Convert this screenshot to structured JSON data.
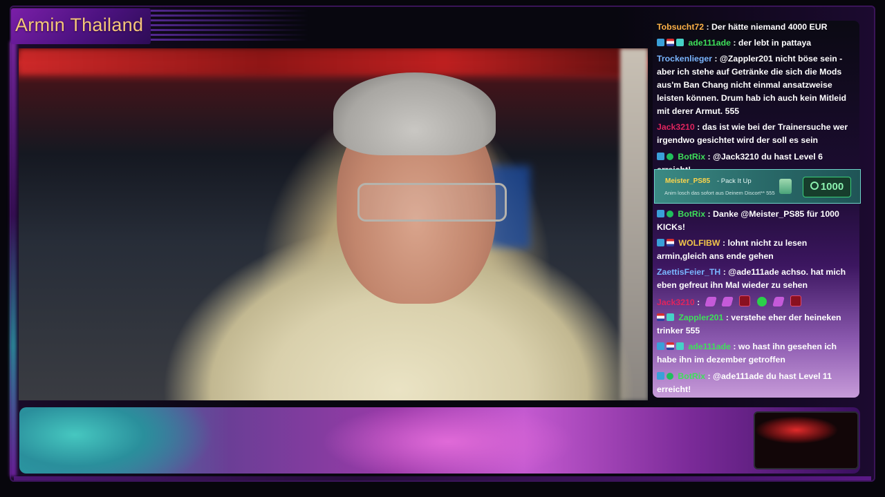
{
  "overlay": {
    "title": "Armin Thailand"
  },
  "chat": {
    "messages": [
      {
        "user": "Tobsucht72",
        "color": "#ffb347",
        "badges": [],
        "text": ": Der hätte niemand 4000 EUR"
      },
      {
        "user": "ade111ade",
        "color": "#3ee05a",
        "badges": [
          "sub",
          "flag",
          "gift"
        ],
        "text": ": der lebt in pattaya"
      },
      {
        "user": "Trockenlieger",
        "color": "#7ab6ff",
        "badges": [],
        "text": ": @Zappler201 nicht böse sein - aber ich stehe auf Getränke die sich die Mods aus'm Ban Chang nicht einmal ansatzweise leisten können. Drum hab ich auch kein Mitleid mit derer Armut. 555"
      },
      {
        "user": "Jack3210",
        "color": "#e0245e",
        "badges": [],
        "text": ": das ist wie bei der Trainersuche wer irgendwo gesichtet wird der soll es sein"
      },
      {
        "user": "BotRix",
        "color": "#3ee05a",
        "badges": [
          "sub",
          "verified"
        ],
        "text": ": @Jack3210 du hast Level 6 erreicht!"
      },
      {
        "user": "BotRix",
        "color": "#3ee05a",
        "badges": [
          "sub",
          "verified"
        ],
        "text": ": Danke @Meister_PS85 für 1000 KICKs!"
      },
      {
        "user": "WOLFIBW",
        "color": "#f3c64a",
        "badges": [
          "sub",
          "flag"
        ],
        "text": ": lohnt nicht zu lesen armin,gleich ans ende gehen"
      },
      {
        "user": "ZaettisFeier_TH",
        "color": "#7ab6ff",
        "badges": [],
        "text": ": @ade111ade achso. hat mich eben gefreut ihn Mal wieder zu sehen"
      },
      {
        "user": "Jack3210",
        "color": "#e0245e",
        "badges": [],
        "text": ":"
      },
      {
        "user": "Zappler201",
        "color": "#3ee05a",
        "badges": [
          "flag",
          "gift"
        ],
        "text": ": verstehe eher der heineken trinker 555"
      },
      {
        "user": "ade111ade",
        "color": "#3ee05a",
        "badges": [
          "sub",
          "flag",
          "gift"
        ],
        "text": ": wo hast ihn gesehen ich habe ihn im dezember getroffen"
      },
      {
        "user": "BotRix",
        "color": "#3ee05a",
        "badges": [
          "sub",
          "verified"
        ],
        "text": ": @ade111ade du hast Level 11 erreicht!"
      }
    ],
    "gift": {
      "user": "Meister_PS85",
      "title": "- Pack It Up",
      "note": "Anim losch das sofort aus Deinem Discort** 555",
      "amount": "1000"
    }
  }
}
